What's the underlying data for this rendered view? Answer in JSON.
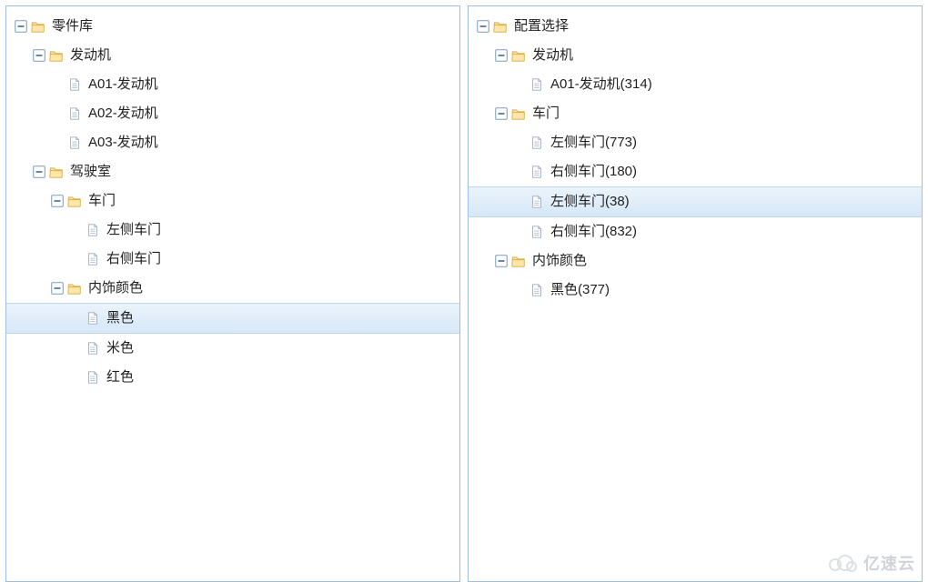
{
  "watermark": {
    "text": "亿速云"
  },
  "icons": {
    "folder_open": "folder-open-icon",
    "file": "file-icon",
    "expander_minus": "minus-box-icon"
  },
  "left_tree": {
    "title_slug": "parts-library",
    "nodes": [
      {
        "id": "lib",
        "label": "零件库",
        "depth": 0,
        "kind": "folder",
        "expanded": true,
        "selected": false
      },
      {
        "id": "engine",
        "label": "发动机",
        "depth": 1,
        "kind": "folder",
        "expanded": true,
        "selected": false
      },
      {
        "id": "a01",
        "label": "A01-发动机",
        "depth": 2,
        "kind": "leaf",
        "selected": false
      },
      {
        "id": "a02",
        "label": "A02-发动机",
        "depth": 2,
        "kind": "leaf",
        "selected": false
      },
      {
        "id": "a03",
        "label": "A03-发动机",
        "depth": 2,
        "kind": "leaf",
        "selected": false
      },
      {
        "id": "cab",
        "label": "驾驶室",
        "depth": 1,
        "kind": "folder",
        "expanded": true,
        "selected": false
      },
      {
        "id": "doors",
        "label": "车门",
        "depth": 2,
        "kind": "folder",
        "expanded": true,
        "selected": false
      },
      {
        "id": "door-l",
        "label": "左侧车门",
        "depth": 3,
        "kind": "leaf",
        "selected": false
      },
      {
        "id": "door-r",
        "label": "右侧车门",
        "depth": 3,
        "kind": "leaf",
        "selected": false
      },
      {
        "id": "trim",
        "label": "内饰颜色",
        "depth": 2,
        "kind": "folder",
        "expanded": true,
        "selected": false
      },
      {
        "id": "black",
        "label": "黑色",
        "depth": 3,
        "kind": "leaf",
        "selected": true
      },
      {
        "id": "beige",
        "label": "米色",
        "depth": 3,
        "kind": "leaf",
        "selected": false
      },
      {
        "id": "red",
        "label": "红色",
        "depth": 3,
        "kind": "leaf",
        "selected": false
      }
    ]
  },
  "right_tree": {
    "title_slug": "config-selection",
    "nodes": [
      {
        "id": "cfg",
        "label": "配置选择",
        "depth": 0,
        "kind": "folder",
        "expanded": true,
        "selected": false
      },
      {
        "id": "cfg-engine",
        "label": "发动机",
        "depth": 1,
        "kind": "folder",
        "expanded": true,
        "selected": false
      },
      {
        "id": "cfg-a01",
        "label": "A01-发动机(314)",
        "depth": 2,
        "kind": "leaf",
        "selected": false
      },
      {
        "id": "cfg-doors",
        "label": "车门",
        "depth": 1,
        "kind": "folder",
        "expanded": true,
        "selected": false
      },
      {
        "id": "cfg-d1",
        "label": "左侧车门(773)",
        "depth": 2,
        "kind": "leaf",
        "selected": false
      },
      {
        "id": "cfg-d2",
        "label": "右侧车门(180)",
        "depth": 2,
        "kind": "leaf",
        "selected": false
      },
      {
        "id": "cfg-d3",
        "label": "左侧车门(38)",
        "depth": 2,
        "kind": "leaf",
        "selected": true
      },
      {
        "id": "cfg-d4",
        "label": "右侧车门(832)",
        "depth": 2,
        "kind": "leaf",
        "selected": false
      },
      {
        "id": "cfg-trim",
        "label": "内饰颜色",
        "depth": 1,
        "kind": "folder",
        "expanded": true,
        "selected": false
      },
      {
        "id": "cfg-black",
        "label": "黑色(377)",
        "depth": 2,
        "kind": "leaf",
        "selected": false
      }
    ]
  }
}
